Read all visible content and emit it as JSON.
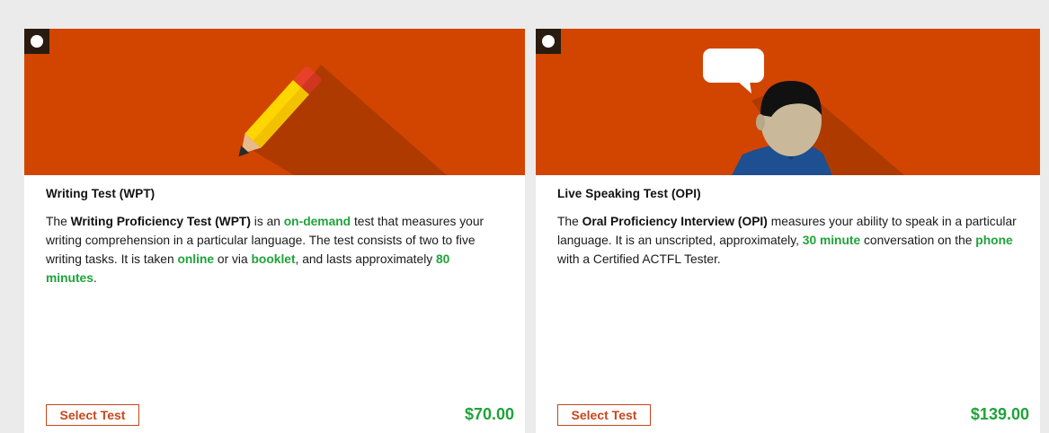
{
  "colors": {
    "hero_background": "#d24500",
    "accent_green": "#1fa33a",
    "button_border": "#c8461b"
  },
  "cards": [
    {
      "illustration": "pencil-icon",
      "title": "Writing Test (WPT)",
      "desc": {
        "p1": "The ",
        "b1": "Writing Proficiency Test (WPT)",
        "p2": " is an ",
        "h1": "on-demand",
        "p3": " test that measures your writing comprehension in a particular language. The test consists of two to five writing tasks. It is taken ",
        "h2": "online",
        "p4": " or via ",
        "h3": "booklet",
        "p5": ", and lasts approximately ",
        "h4": "80 minutes",
        "p6": "."
      },
      "button_label": "Select Test",
      "price": "$70.00"
    },
    {
      "illustration": "speaker-person-icon",
      "title": "Live Speaking Test (OPI)",
      "desc": {
        "p1": "The ",
        "b1": "Oral Proficiency Interview (OPI)",
        "p2": " measures your ability to speak in a particular language. It is an unscripted, approximately, ",
        "h1": "30 minute",
        "p3": " conversation on the ",
        "h2": "phone",
        "p4": " with a Certified ACTFL Tester."
      },
      "button_label": "Select Test",
      "price": "$139.00"
    }
  ]
}
